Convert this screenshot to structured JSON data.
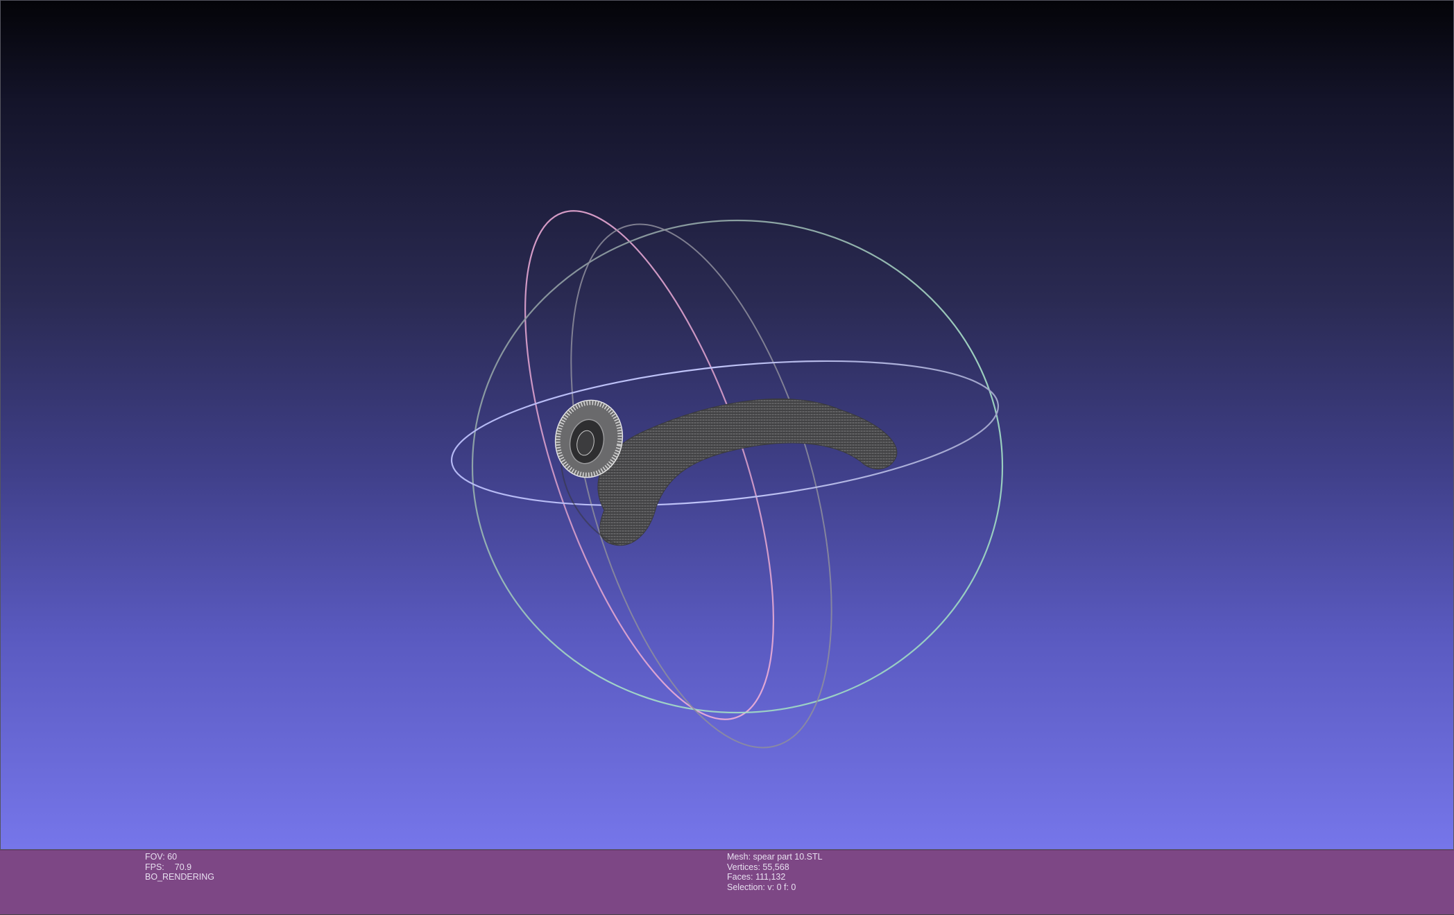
{
  "viewport": {
    "background_top": "#040408",
    "background_bottom": "#7676ea",
    "trackball": {
      "equator_color": "#a9aef0",
      "meridian_pink_color": "#e8a8d4",
      "meridian_green_color": "#a8e0c8"
    },
    "mesh": {
      "color": "#4a4a4c",
      "wire_color": "#d8d8d8"
    }
  },
  "status_left": {
    "fov": "FOV: 60",
    "fps_label": "FPS:",
    "fps_value": "70.9",
    "render_mode": "BO_RENDERING"
  },
  "status_right": {
    "mesh": "Mesh: spear part 10.STL",
    "vertices": "Vertices: 55,568",
    "faces": "Faces: 111,132",
    "selection": "Selection: v: 0 f: 0"
  }
}
